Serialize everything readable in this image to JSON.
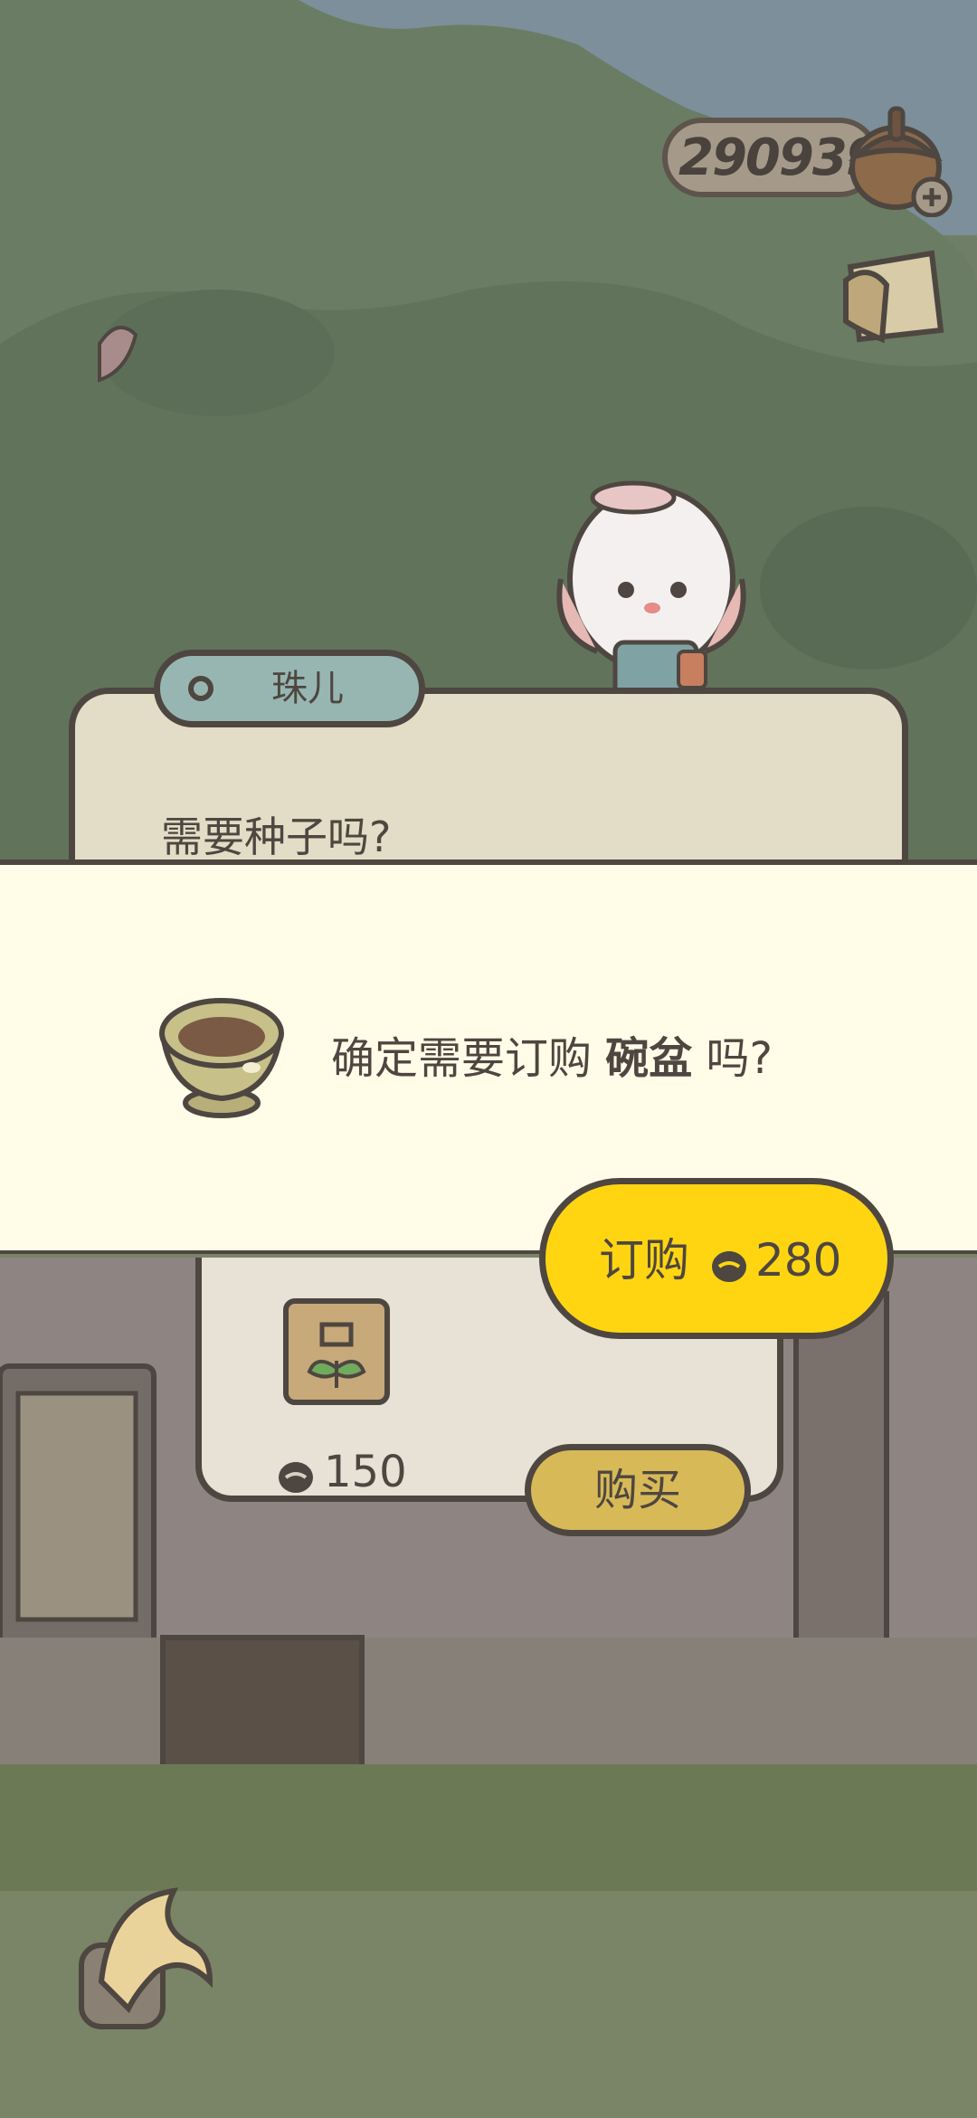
{
  "hud": {
    "currency_value": "290939",
    "acorn_icon": "acorn-plus-icon",
    "mail_icon": "letter-icon"
  },
  "dialog": {
    "speaker_name": "珠儿",
    "text": "需要种子吗?"
  },
  "confirm": {
    "prefix": "确定需要订购 ",
    "item_name": "碗盆",
    "suffix": " 吗?",
    "item_icon": "bowl-icon"
  },
  "order_button": {
    "label": "订购",
    "price": "280",
    "currency_icon": "acorn-icon"
  },
  "shop": {
    "seed_price": "150",
    "buy_label": "购买",
    "seed_icon": "seed-bag-icon"
  },
  "nav": {
    "back_icon": "back-arrow-icon"
  },
  "colors": {
    "accent_yellow": "#ffd512",
    "buy_gold": "#d7b957",
    "panel_cream": "#fffde8",
    "outline": "#4e4640"
  }
}
